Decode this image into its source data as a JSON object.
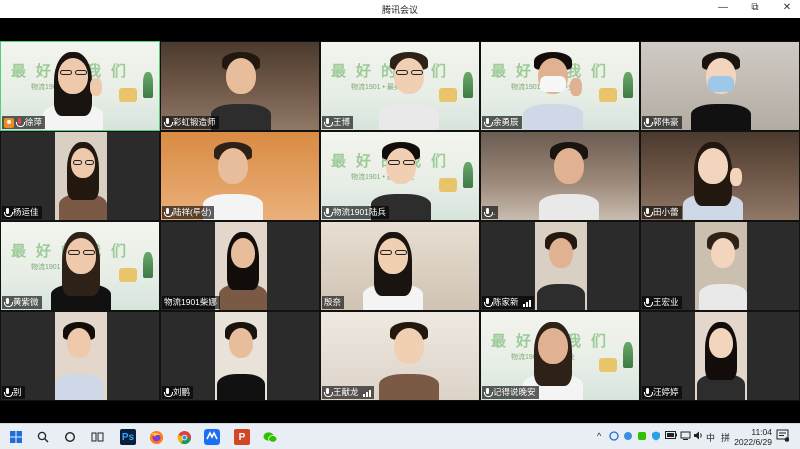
{
  "window": {
    "title": "腾讯会议",
    "controls": {
      "minimize": "—",
      "restore": "⧉",
      "close": "✕"
    }
  },
  "participants": [
    {
      "name": "徐萍",
      "host": true,
      "mic": "muted",
      "bg": "banner",
      "active": true
    },
    {
      "name": "彩虹锻造师",
      "mic": "on",
      "bg": "shelf"
    },
    {
      "name": "王博",
      "mic": "on",
      "bg": "banner"
    },
    {
      "name": "余勇辰",
      "mic": "on",
      "bg": "banner"
    },
    {
      "name": "郭伟豪",
      "mic": "on",
      "bg": "grey"
    },
    {
      "name": "杨运佳",
      "mic": "on",
      "bg": "dark"
    },
    {
      "name": "陆祥(루상)",
      "mic": "on",
      "bg": "orange"
    },
    {
      "name": "物流1901陆兵",
      "mic": "on",
      "bg": "banner"
    },
    {
      "name": ".",
      "mic": "on",
      "bg": "room"
    },
    {
      "name": "田小蕾",
      "mic": "on",
      "bg": "shelf"
    },
    {
      "name": "黄紫微",
      "mic": "on",
      "bg": "banner"
    },
    {
      "name": "物流1901柴娜",
      "mic": "none",
      "bg": "dark"
    },
    {
      "name": "殷奈",
      "mic": "none",
      "bg": "cream"
    },
    {
      "name": "陈家新",
      "mic": "on",
      "bg": "dark",
      "signal": true
    },
    {
      "name": "王宏业",
      "mic": "on",
      "bg": "dark"
    },
    {
      "name": "别",
      "mic": "on",
      "bg": "dark"
    },
    {
      "name": "刘鹏",
      "mic": "on",
      "bg": "dark"
    },
    {
      "name": "王献龙",
      "mic": "on",
      "bg": "wall",
      "signal": true
    },
    {
      "name": "记得说晚安",
      "mic": "on",
      "bg": "banner"
    },
    {
      "name": "汪婷婷",
      "mic": "on",
      "bg": "dark"
    }
  ],
  "banner": {
    "text": "最好的我们",
    "sub": "物流1901 • 最美毕业"
  },
  "taskbar": {
    "start_icon": "windows-start-icon",
    "apps": [
      "search-icon",
      "cortana-icon",
      "task-view-icon",
      "photoshop-icon",
      "firefox-icon",
      "chrome-icon",
      "tencent-meeting-icon",
      "powerpoint-icon",
      "wechat-icon"
    ],
    "ps_label": "Ps",
    "ppt_label": "P",
    "tray_lang": "中",
    "tray_ime": "拼",
    "time": "11:04",
    "date": "2022/6/29"
  },
  "colors": {
    "active_border": "#4fd17c",
    "muted_mic": "#e4463b",
    "host_badge": "#f08a24"
  }
}
